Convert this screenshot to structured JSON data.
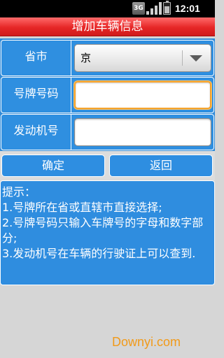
{
  "status_bar": {
    "network_label": "3G",
    "time": "12:01 PM",
    "signal_level": 1.0,
    "battery_level": 0.7
  },
  "title": "增加车辆信息",
  "form": {
    "province": {
      "label": "省市",
      "value": "京"
    },
    "plate": {
      "label": "号牌号码",
      "value": "",
      "placeholder": ""
    },
    "engine": {
      "label": "发动机号",
      "value": "",
      "placeholder": ""
    }
  },
  "buttons": {
    "confirm": "确定",
    "back": "返回"
  },
  "tips": {
    "lines": [
      "提示：",
      "1.号牌所在省或直辖市直接选择;",
      "2.号牌号码只输入车牌号的字母和数字部分;",
      "3.发动机号在车辆的行驶证上可以查到."
    ]
  },
  "watermark": "Downyi.com",
  "colors": {
    "title_bar": "#e62727",
    "panel_blue": "#2f8fe0",
    "focus_orange": "#f3a22c",
    "watermark": "#f19a1a"
  }
}
